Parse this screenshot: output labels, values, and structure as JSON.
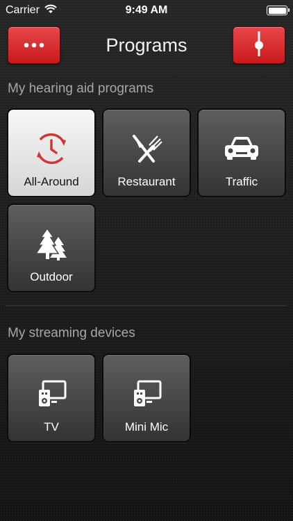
{
  "status_bar": {
    "carrier": "Carrier",
    "time": "9:49 AM",
    "wifi_icon": "wifi-icon",
    "battery_level": 1.0
  },
  "nav": {
    "title": "Programs",
    "left_button_icon": "more-dots-icon",
    "right_button_icon": "volume-slider-icon",
    "accent_color": "#d92b2e"
  },
  "sections": {
    "programs": {
      "title": "My hearing aid programs",
      "items": [
        {
          "label": "All-Around",
          "icon": "all-around-icon",
          "selected": true
        },
        {
          "label": "Restaurant",
          "icon": "fork-knife-icon",
          "selected": false
        },
        {
          "label": "Traffic",
          "icon": "car-icon",
          "selected": false
        },
        {
          "label": "Outdoor",
          "icon": "trees-icon",
          "selected": false
        }
      ]
    },
    "streaming": {
      "title": "My streaming devices",
      "items": [
        {
          "label": "TV",
          "icon": "tv-streamer-icon"
        },
        {
          "label": "Mini Mic",
          "icon": "mini-mic-streamer-icon"
        }
      ]
    }
  }
}
